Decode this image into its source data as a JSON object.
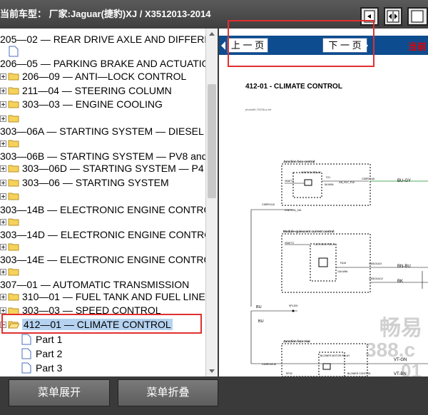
{
  "header": {
    "vehicle_info": "当前车型：   厂家:Jaguar(捷豹)XJ / X3512013-2014",
    "icons": [
      "fit-page-icon",
      "fit-width-icon",
      "page-icon"
    ]
  },
  "tree": {
    "nodes": [
      {
        "label": "205—02 — REAR DRIVE AXLE AND DIFFERENTIAL",
        "icon": "none"
      },
      {
        "label": "",
        "icon": "doc"
      },
      {
        "label": "206—05 — PARKING BRAKE AND ACTUATION",
        "icon": "none"
      },
      {
        "label": "206—09 — ANTI—LOCK CONTROL",
        "icon": "folder"
      },
      {
        "label": "211—04 — STEERING COLUMN",
        "icon": "folder"
      },
      {
        "label": "303—03 — ENGINE COOLING",
        "icon": "folder"
      },
      {
        "label": "",
        "icon": "folder"
      },
      {
        "label": "303—06A — STARTING SYSTEM — DIESEL",
        "icon": "none"
      },
      {
        "label": "",
        "icon": "folder"
      },
      {
        "label": "303—06B — STARTING SYSTEM — PV8 and PV6",
        "icon": "none"
      },
      {
        "label": "303—06D — STARTING SYSTEM — P4",
        "icon": "folder"
      },
      {
        "label": "303—06 — STARTING SYSTEM",
        "icon": "folder"
      },
      {
        "label": "",
        "icon": "folder"
      },
      {
        "label": "303—14B — ELECTRONIC ENGINE CONTROLS —",
        "icon": "none"
      },
      {
        "label": "",
        "icon": "folder"
      },
      {
        "label": "303—14D — ELECTRONIC ENGINE CONTROLS —",
        "icon": "none"
      },
      {
        "label": "",
        "icon": "folder"
      },
      {
        "label": "303—14E — ELECTRONIC ENGINE CONTROLS —",
        "icon": "none"
      },
      {
        "label": "",
        "icon": "folder"
      },
      {
        "label": "307—01 — AUTOMATIC TRANSMISSION",
        "icon": "none"
      },
      {
        "label": "310—01 — FUEL TANK AND FUEL LINES",
        "icon": "folder"
      },
      {
        "label": "303—03 — SPEED CONTROL",
        "icon": "folder"
      },
      {
        "label": "412—01 — CLIMATE CONTROL",
        "icon": "folder-open"
      },
      {
        "label": "Part 1",
        "icon": "doc"
      },
      {
        "label": "Part 2",
        "icon": "doc"
      },
      {
        "label": "Part 3",
        "icon": "doc"
      }
    ]
  },
  "viewer": {
    "prev_label": "上 一 页",
    "next_label": "下 一 页",
    "current_label": "当前",
    "doc_title": "412-01 - CLIMATE CONTROL",
    "doc_ref": "photo65-70206-a.ref",
    "labels": {
      "jb_central": "Junction box-central",
      "ignition_relay": "IGNITION RELAY",
      "vbatt": "VBATT2",
      "f21": "F21",
      "f21_spec": "5A MINI",
      "gnd": "GN_RLY_F18",
      "c3bp01": "C3BP01/46",
      "bu_gy": "BU-GY",
      "c3bp01_16": "C3BP01/16",
      "ign_150": "IGNITION_150",
      "module": "Module-quiescent current control",
      "latching": "LATCHING RELAY",
      "fa15": "FA15",
      "fa15_spec": "10A MINI",
      "c4b": "C4B101A/3",
      "c4b12": "C4B101A/12",
      "bn_bu": "BN-BU",
      "bk": "BK",
      "bu": "BU",
      "spl": "SPL200",
      "bu2": "BU",
      "jb_rear": "Junction box-rear",
      "blower_motor": "BLOWER MOTOR RELAY",
      "vt_gn": "VT-GN",
      "vt_bn": "VT-BN",
      "c4br": "C4BR016/16",
      "blower_ctrl": "BLOWER CONTROL",
      "rf34": "RF34",
      "rf34_spec": "40A JCASE"
    }
  },
  "buttons": {
    "expand_all": "菜单展开",
    "collapse_all": "菜单折叠"
  },
  "watermark": {
    "line1": "畅易",
    "line2": "388.c",
    "line3": "01"
  },
  "colors": {
    "nav_blue": "#0d4d8f",
    "highlight_red": "#e03030",
    "current_red": "#e00000",
    "diagram_green": "#1a8f2a"
  }
}
